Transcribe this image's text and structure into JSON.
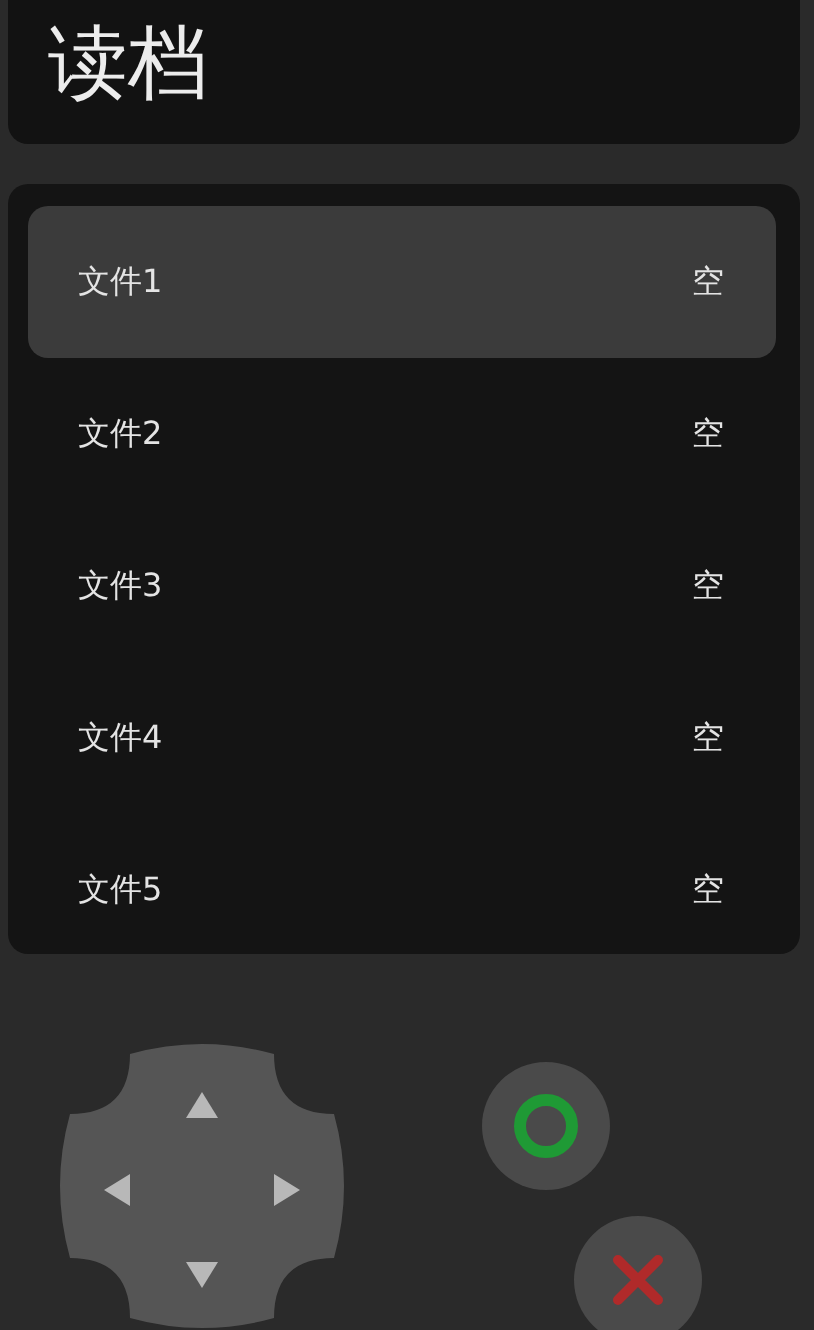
{
  "title": "读档",
  "slots": [
    {
      "label": "文件1",
      "status": "空",
      "selected": true
    },
    {
      "label": "文件2",
      "status": "空",
      "selected": false
    },
    {
      "label": "文件3",
      "status": "空",
      "selected": false
    },
    {
      "label": "文件4",
      "status": "空",
      "selected": false
    },
    {
      "label": "文件5",
      "status": "空",
      "selected": false
    }
  ]
}
